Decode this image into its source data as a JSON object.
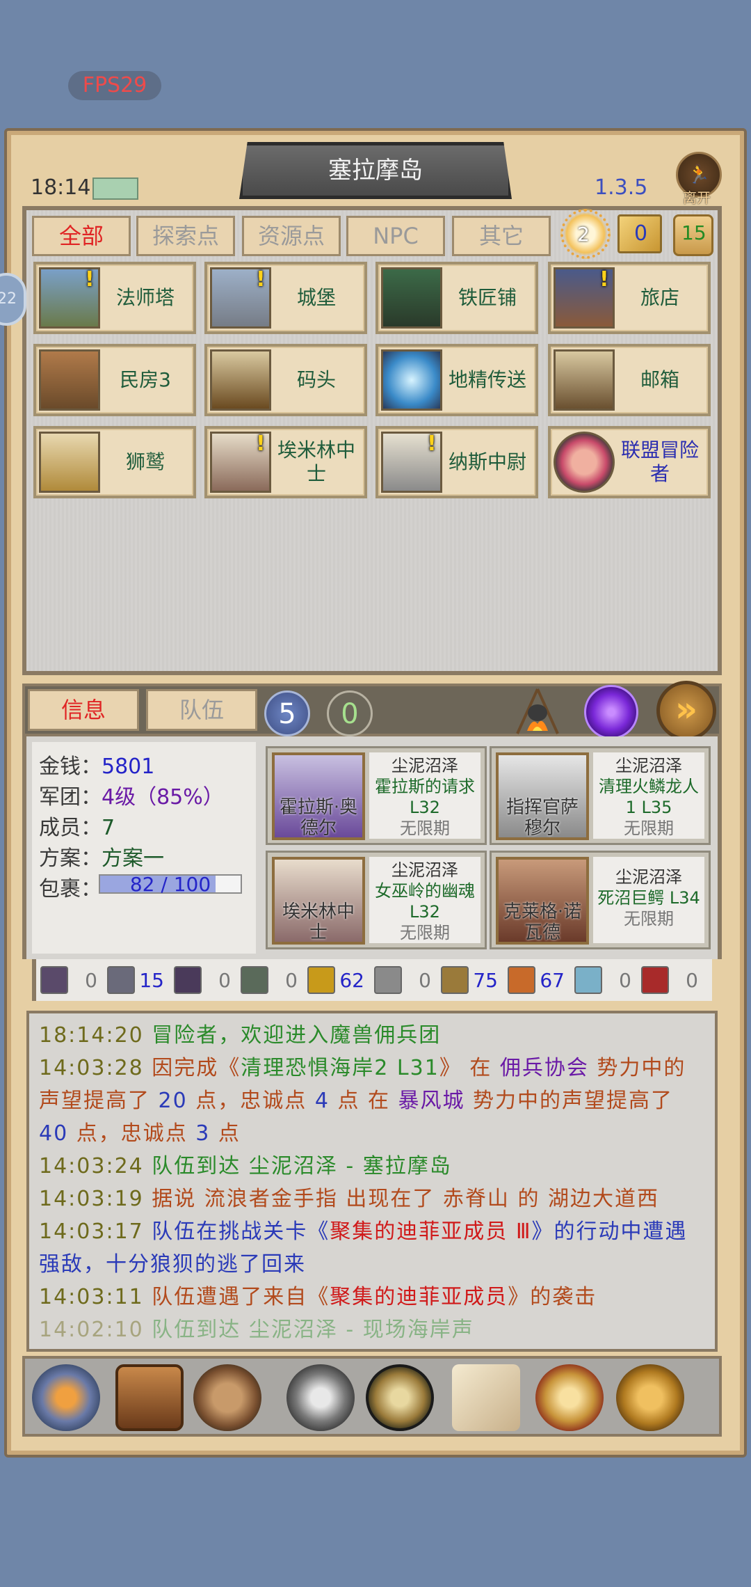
{
  "fps": "FPS29",
  "header": {
    "location": "塞拉摩岛",
    "time": "18:14",
    "version": "1.3.5",
    "leave_label": "离开"
  },
  "filters": [
    "全部",
    "探索点",
    "资源点",
    "NPC",
    "其它"
  ],
  "counters": {
    "sun": "2",
    "mail": "0",
    "scroll": "15"
  },
  "side_badge": "22",
  "locations": [
    {
      "name": "法师塔",
      "alert": true
    },
    {
      "name": "城堡",
      "alert": true
    },
    {
      "name": "铁匠铺",
      "alert": false
    },
    {
      "name": "旅店",
      "alert": true
    },
    {
      "name": "民房3",
      "alert": false
    },
    {
      "name": "码头",
      "alert": false
    },
    {
      "name": "地精传送",
      "alert": false
    },
    {
      "name": "邮箱",
      "alert": false
    },
    {
      "name": "狮鹫",
      "alert": false
    },
    {
      "name": "埃米林中士",
      "alert": true
    },
    {
      "name": "纳斯中尉",
      "alert": true
    },
    {
      "name": "联盟冒险者",
      "alert": false
    }
  ],
  "info_tabs": [
    "信息",
    "队伍"
  ],
  "badges": {
    "five": "5",
    "zero": "0"
  },
  "stats": {
    "money_label": "金钱：",
    "money": "5801",
    "legion_label": "军团：",
    "legion": "4级（85%）",
    "members_label": "成员：",
    "members": "7",
    "plan_label": "方案：",
    "plan": "方案一",
    "bag_label": "包裹：",
    "bag": "82 / 100",
    "bag_fraction": 0.82
  },
  "quests": [
    {
      "npc": "霍拉斯·奥德尔",
      "zone": "尘泥沼泽",
      "title": "霍拉斯的请求",
      "level": "L32",
      "expire": "无限期"
    },
    {
      "npc": "指挥官萨穆尔",
      "zone": "尘泥沼泽",
      "title": "清理火鳞龙人",
      "level": "1 L35",
      "expire": "无限期"
    },
    {
      "npc": "埃米林中士",
      "zone": "尘泥沼泽",
      "title": "女巫岭的幽魂",
      "level": "L32",
      "expire": "无限期"
    },
    {
      "npc": "克莱格·诺瓦德",
      "zone": "尘泥沼泽",
      "title": "死沼巨鳄 L34",
      "level": "",
      "expire": "无限期"
    }
  ],
  "resources": [
    "0",
    "15",
    "0",
    "0",
    "62",
    "0",
    "75",
    "67",
    "0",
    "0"
  ],
  "log": {
    "l1_time": "18:14:20",
    "l1_msg": "冒险者，欢迎进入魔兽佣兵团",
    "l2_time": "14:03:28",
    "l2_a": "因完成《",
    "l2_quest": "清理恐惧海岸2 L31",
    "l2_b": "》 在 ",
    "l2_org": "佣兵协会",
    "l2_c": " 势力中的声望提高了 ",
    "l2_n1": "20",
    "l2_d": " 点，忠诚点 ",
    "l2_n2": "4",
    "l2_e": " 点 在 ",
    "l2_org2": "暴风城",
    "l2_f": " 势力中的声望提高了 ",
    "l2_n3": "40",
    "l2_g": " 点，忠诚点 ",
    "l2_n4": "3",
    "l2_h": " 点",
    "l3_time": "14:03:24",
    "l3_msg": "队伍到达 尘泥沼泽 - 塞拉摩岛",
    "l4_time": "14:03:19",
    "l4_msg": "据说 流浪者金手指 出现在了 赤脊山 的 湖边大道西",
    "l5_time": "14:03:17",
    "l5_a": "队伍在挑战关卡《",
    "l5_quest": "聚集的迪菲亚成员 Ⅲ",
    "l5_b": "》的行动中遭遇强敌，十分狼狈的逃了回来",
    "l6_time": "14:03:11",
    "l6_a": "队伍遭遇了来自《",
    "l6_quest": "聚集的迪菲亚成员",
    "l6_b": "》的袭击",
    "l7_time": "14:02:10",
    "l7_msg": "队伍到达 尘泥沼泽 - 现场海岸声"
  },
  "menu": [
    "hero-crest-icon",
    "treasure-chest-icon",
    "dwarf-helm-icon",
    "armor-icon",
    "compass-rune-icon",
    "quest-scroll-icon",
    "trophy-icon",
    "settings-gears-icon"
  ]
}
